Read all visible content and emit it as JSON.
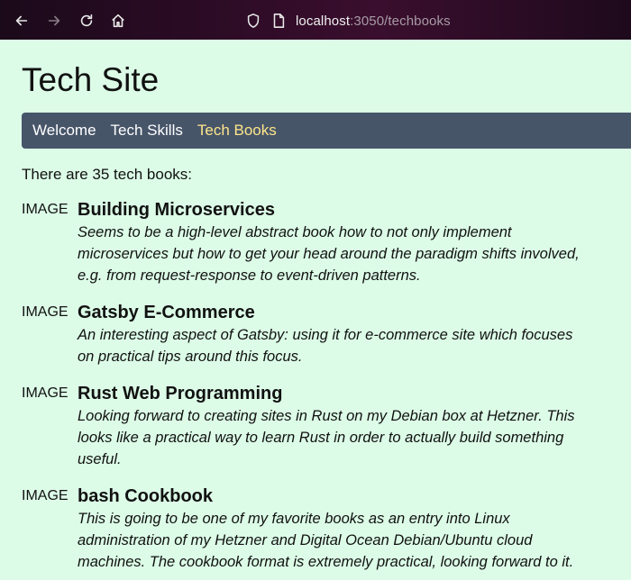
{
  "browser": {
    "url_host": "localhost",
    "url_rest": ":3050/techbooks"
  },
  "site": {
    "title": "Tech Site"
  },
  "nav": {
    "items": [
      {
        "label": "Welcome"
      },
      {
        "label": "Tech Skills"
      },
      {
        "label": "Tech Books"
      }
    ],
    "active_color": "#fde68a",
    "bar_color": "#475569"
  },
  "count_text": "There are 35 tech books:",
  "books": [
    {
      "image_label": "IMAGE",
      "title": "Building Microservices",
      "description": "Seems to be a high-level abstract book how to not only implement microservices but how to get your head around the paradigm shifts involved, e.g. from request-response to event-driven patterns."
    },
    {
      "image_label": "IMAGE",
      "title": "Gatsby E-Commerce",
      "description": "An interesting aspect of Gatsby: using it for e-commerce site which focuses on practical tips around this focus."
    },
    {
      "image_label": "IMAGE",
      "title": "Rust Web Programming",
      "description": "Looking forward to creating sites in Rust on my Debian box at Hetzner. This looks like a practical way to learn Rust in order to actually build something useful."
    },
    {
      "image_label": "IMAGE",
      "title": "bash Cookbook",
      "description": "This is going to be one of my favorite books as an entry into Linux administration of my Hetzner and Digital Ocean Debian/Ubuntu cloud machines. The cookbook format is extremely practical, looking forward to it."
    }
  ]
}
